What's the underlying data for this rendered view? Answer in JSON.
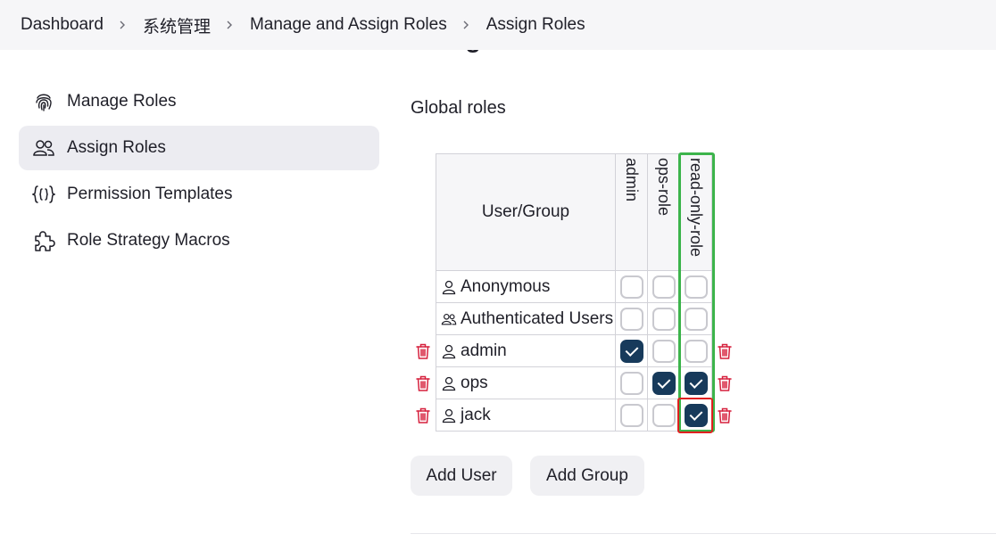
{
  "breadcrumb": [
    "Dashboard",
    "系统管理",
    "Manage and Assign Roles",
    "Assign Roles"
  ],
  "page_title": "Assign Roles",
  "sidebar": {
    "items": [
      {
        "label": "Manage Roles",
        "icon": "fingerprint-icon",
        "active": false
      },
      {
        "label": "Assign Roles",
        "icon": "users-icon",
        "active": true
      },
      {
        "label": "Permission Templates",
        "icon": "braces-icon",
        "active": false
      },
      {
        "label": "Role Strategy Macros",
        "icon": "puzzle-icon",
        "active": false
      }
    ]
  },
  "section_title": "Global roles",
  "table": {
    "header_user_group": "User/Group",
    "roles": [
      "admin",
      "ops-role",
      "read-only-role"
    ],
    "rows": [
      {
        "name": "Anonymous",
        "icon": "user-icon",
        "deletable": false,
        "checks": [
          false,
          false,
          false
        ]
      },
      {
        "name": "Authenticated Users",
        "icon": "group-icon",
        "deletable": false,
        "checks": [
          false,
          false,
          false
        ]
      },
      {
        "name": "admin",
        "icon": "user-icon",
        "deletable": true,
        "checks": [
          true,
          false,
          false
        ]
      },
      {
        "name": "ops",
        "icon": "user-icon",
        "deletable": true,
        "checks": [
          false,
          true,
          true
        ]
      },
      {
        "name": "jack",
        "icon": "user-icon",
        "deletable": true,
        "checks": [
          false,
          false,
          true
        ]
      }
    ]
  },
  "buttons": {
    "add_user": "Add User",
    "add_group": "Add Group"
  },
  "colors": {
    "checked": "#173a5b",
    "delete": "#d6203d",
    "highlight_green": "#3cb44b",
    "highlight_red": "#e02020"
  }
}
